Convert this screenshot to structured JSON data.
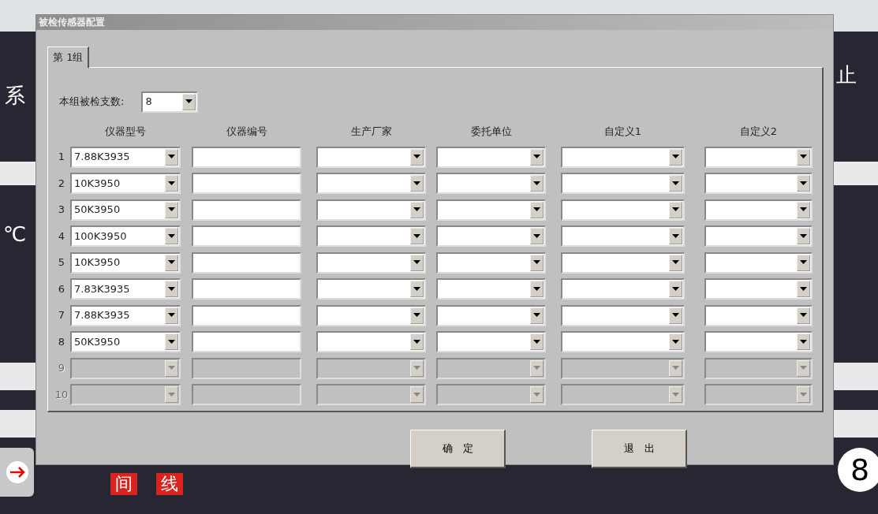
{
  "background_app": {
    "texts": [
      {
        "kind": "heading",
        "text": "系"
      },
      {
        "kind": "side",
        "text": "止"
      },
      {
        "kind": "unit",
        "text": "℃"
      },
      {
        "kind": "tag",
        "text": "间"
      },
      {
        "kind": "tag",
        "text": "线"
      },
      {
        "kind": "digit",
        "text": "8"
      }
    ]
  },
  "dialog": {
    "title": "被检传感器配置",
    "tabs": [
      {
        "label": "第 1组",
        "selected": true
      }
    ],
    "count": {
      "label": "本组被检支数:",
      "value": "8"
    },
    "columns": [
      "仪器型号",
      "仪器编号",
      "生产厂家",
      "委托单位",
      "自定义1",
      "自定义2"
    ],
    "rows": [
      {
        "index": "1",
        "enabled": true,
        "model": "7.88K3935"
      },
      {
        "index": "2",
        "enabled": true,
        "model": "10K3950"
      },
      {
        "index": "3",
        "enabled": true,
        "model": "50K3950"
      },
      {
        "index": "4",
        "enabled": true,
        "model": "100K3950"
      },
      {
        "index": "5",
        "enabled": true,
        "model": "10K3950"
      },
      {
        "index": "6",
        "enabled": true,
        "model": "7.83K3935"
      },
      {
        "index": "7",
        "enabled": true,
        "model": "7.88K3935"
      },
      {
        "index": "8",
        "enabled": true,
        "model": "50K3950"
      },
      {
        "index": "9",
        "enabled": false
      },
      {
        "index": "10",
        "enabled": false
      }
    ],
    "buttons": [
      "确　定",
      "退　出"
    ]
  }
}
